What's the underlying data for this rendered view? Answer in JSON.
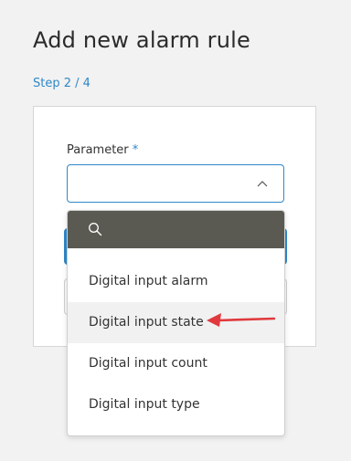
{
  "header": {
    "title": "Add new alarm rule",
    "step": "Step 2 / 4"
  },
  "form": {
    "parameter_label": "Parameter",
    "required_mark": "*",
    "select_value": ""
  },
  "dropdown": {
    "search_placeholder": "",
    "options": [
      {
        "label": "Digital input alarm"
      },
      {
        "label": "Digital input state"
      },
      {
        "label": "Digital input count"
      },
      {
        "label": "Digital input type"
      }
    ]
  },
  "colors": {
    "accent": "#2f88c8",
    "search_bar": "#5b5a52",
    "arrow": "#e0393e",
    "background": "#f2f2f2"
  },
  "icons": {
    "search": "search-icon",
    "chevron": "chevron-up-icon",
    "arrow": "arrow-left-icon"
  }
}
